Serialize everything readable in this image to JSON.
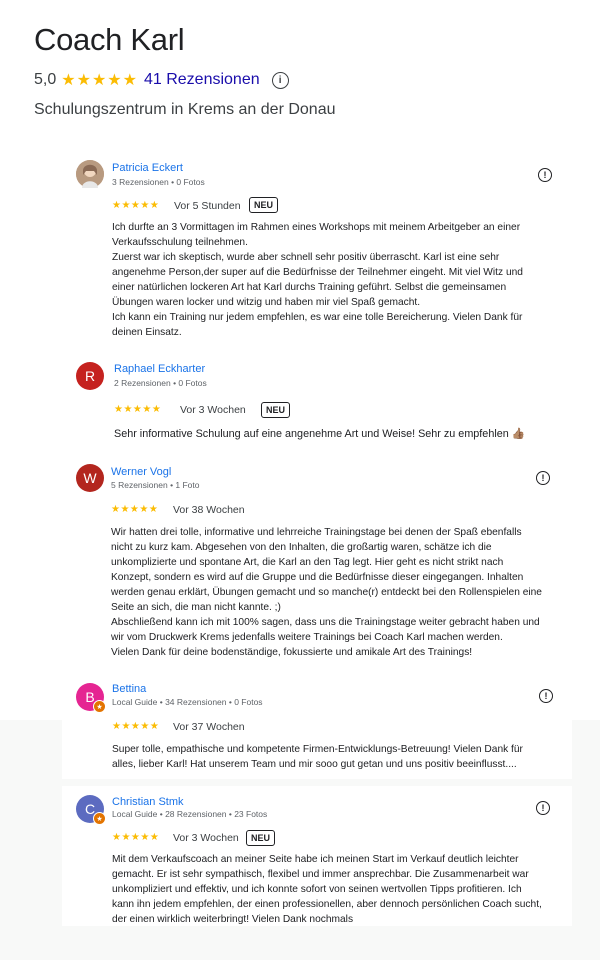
{
  "business": {
    "title": "Coach Karl",
    "rating": "5,0",
    "stars": "★★★★★",
    "reviews_link": "41 Rezensionen",
    "info_icon": "info-icon",
    "category": "Schulungszentrum in Krems an der Donau"
  },
  "reviews": [
    {
      "name": "Patricia Eckert",
      "meta": "3 Rezensionen • 0 Fotos",
      "stars": "★★★★★",
      "time": "Vor 5 Stunden",
      "badge": "NEU",
      "avatar_color": "#c9a98a",
      "text": "Ich durfte an 3 Vormittagen im Rahmen eines Workshops mit meinem Arbeitgeber an einer\nVerkaufsschulung teilnehmen.\nZuerst war ich skeptisch, wurde aber schnell sehr positiv überrascht. Karl ist eine sehr\nangenehme Person,der super auf die Bedürfnisse der Teilnehmer eingeht. Mit viel Witz und\neiner natürlichen lockeren Art hat Karl durchs Training geführt. Selbst die gemeinsamen\nÜbungen waren locker und witzig und haben mir viel Spaß gemacht.\nIch kann ein Training nur jedem empfehlen, es war eine tolle Bereicherung. Vielen Dank für\ndeinen Einsatz."
    },
    {
      "name": "Raphael Eckharter",
      "initial": "R",
      "meta": "2 Rezensionen • 0 Fotos",
      "stars": "★★★★★",
      "time": "Vor 3 Wochen",
      "badge": "NEU",
      "avatar_color": "#c5221f",
      "text": "Sehr informative Schulung auf eine angenehme Art und Weise! Sehr zu empfehlen 👍🏽"
    },
    {
      "name": "Werner Vogl",
      "initial": "W",
      "meta": "5 Rezensionen • 1 Foto",
      "stars": "★★★★★",
      "time": "Vor 38 Wochen",
      "avatar_color": "#b3261e",
      "text": "Wir hatten drei tolle, informative und lehrreiche Trainingstage bei denen der Spaß ebenfalls\nnicht zu kurz kam. Abgesehen von den Inhalten, die großartig waren, schätze ich die\nunkomplizierte und spontane Art, die Karl an den Tag legt. Hier geht es nicht strikt nach\nKonzept, sondern es wird auf die Gruppe und die Bedürfnisse dieser eingegangen. Inhalten\nwerden genau erklärt, Übungen gemacht und so manche(r) entdeckt bei den Rollenspielen eine\nSeite an sich, die man nicht kannte. ;)\nAbschließend kann ich mit 100% sagen, dass uns die Trainingstage weiter gebracht haben und\nwir vom Druckwerk Krems jedenfalls weitere Trainings bei Coach Karl machen werden.\nVielen Dank für deine bodenständige, fokussierte und amikale Art des Trainings!"
    },
    {
      "name": "Bettina",
      "initial": "B",
      "meta": "Local Guide • 34 Rezensionen • 0 Fotos",
      "stars": "★★★★★",
      "time": "Vor 37 Wochen",
      "avatar_color": "#e52592",
      "text": "Super tolle, empathische und kompetente Firmen-Entwicklungs-Betreuung! Vielen Dank für\nalles, lieber Karl! Hat unserem Team und mir sooo gut getan und uns positiv beeinflusst...."
    },
    {
      "name": "Christian Stmk",
      "initial": "C",
      "meta": "Local Guide • 28 Rezensionen • 23 Fotos",
      "stars": "★★★★★",
      "time": "Vor 3 Wochen",
      "badge": "NEU",
      "avatar_color": "#5c6bc0",
      "text": "Mit dem Verkaufscoach an meiner Seite habe ich meinen Start im Verkauf deutlich leichter\ngemacht. Er ist sehr sympathisch, flexibel und immer ansprechbar. Die Zusammenarbeit war\nunkompliziert und effektiv, und ich konnte sofort von seinen wertvollen Tipps profitieren. Ich\nkann ihn jedem empfehlen, der einen professionellen, aber dennoch persönlichen Coach sucht,\nder einen wirklich weiterbringt! Vielen Dank nochmals"
    }
  ]
}
